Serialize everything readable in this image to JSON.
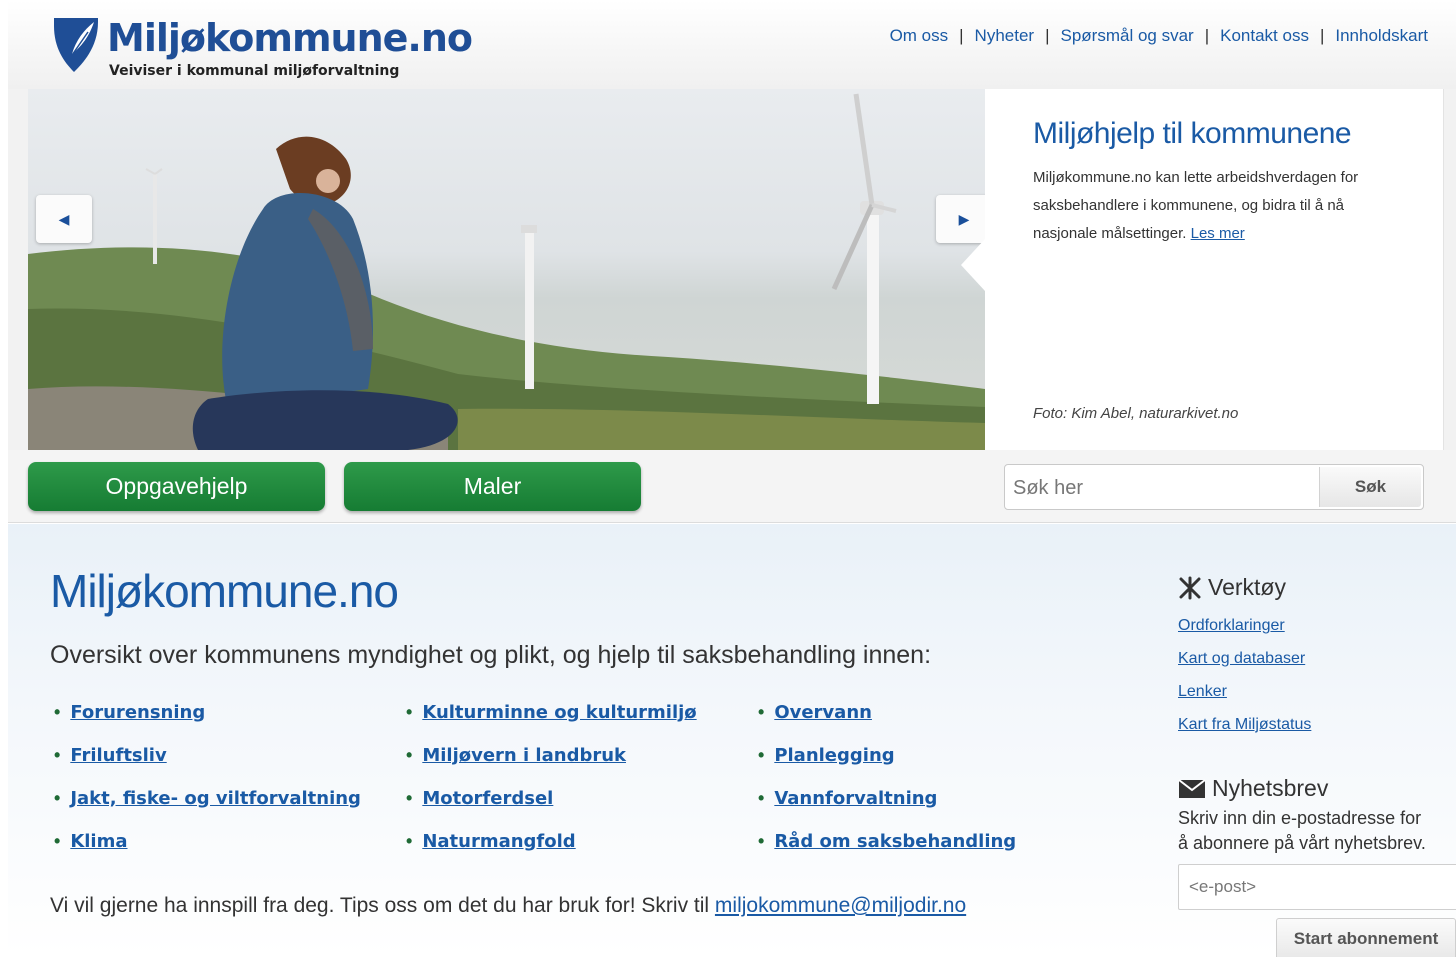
{
  "header": {
    "logo_title": "Miljøkommune.no",
    "logo_subtitle": "Veiviser i kommunal miljøforvaltning",
    "nav": [
      "Om oss",
      "Nyheter",
      "Spørsmål og svar",
      "Kontakt oss",
      "Innholdskart"
    ]
  },
  "slider": {
    "caption_title": "Miljøhjelp til kommunene",
    "caption_text": "Miljøkommune.no kan lette arbeidshverdagen for saksbehandlere i kommunene, og bidra til å nå nasjonale målsettinger.",
    "caption_link": "Les mer",
    "photo_credit": "Foto: Kim Abel, naturarkivet.no"
  },
  "buttons": {
    "oppgavehjelp": "Oppgavehjelp",
    "maler": "Maler"
  },
  "search": {
    "placeholder": "Søk her",
    "button": "Søk"
  },
  "main": {
    "title": "Miljøkommune.no",
    "intro": "Oversikt over kommunens myndighet og plikt, og hjelp til saksbehandling innen:",
    "topics": [
      "Forurensning",
      "Kulturminne og kulturmiljø",
      "Overvann",
      "Friluftsliv",
      "Miljøvern i landbruk",
      "Planlegging",
      "Jakt, fiske- og viltforvaltning",
      "Motorferdsel",
      "Vannforvaltning",
      "Klima",
      "Naturmangfold",
      "Råd om saksbehandling"
    ],
    "feedback_text": "Vi vil gjerne ha innspill fra deg. Tips oss om det du har bruk for! Skriv til ",
    "feedback_email": "miljokommune@miljodir.no"
  },
  "sidebar": {
    "tools_title": "Verktøy",
    "tools_links": [
      "Ordforklaringer",
      "Kart og databaser",
      "Lenker",
      "Kart fra Miljøstatus"
    ],
    "newsletter_title": "Nyhetsbrev",
    "newsletter_text_1": "Skriv inn din e-postadresse for",
    "newsletter_text_2": "å abonnere på vårt nyhetsbrev.",
    "email_placeholder": "<e-post>",
    "subscribe_button": "Start abonnement"
  },
  "colors": {
    "brand_blue": "#1a5aa5",
    "button_green": "#1f8a3d"
  }
}
